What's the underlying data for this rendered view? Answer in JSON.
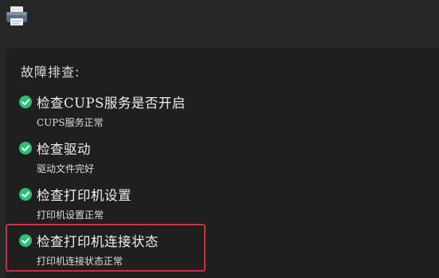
{
  "panel": {
    "title": "故障排查:"
  },
  "steps": [
    {
      "title": "检查CUPS服务是否开启",
      "status": "CUPS服务正常",
      "state": "success"
    },
    {
      "title": "检查驱动",
      "status": "驱动文件完好",
      "state": "success"
    },
    {
      "title": "检查打印机设置",
      "status": "打印机设置正常",
      "state": "success"
    },
    {
      "title": "检查打印机连接状态",
      "status": "打印机连接状态正常",
      "state": "success"
    }
  ],
  "colors": {
    "success": "#2fbf71",
    "highlight": "#c8313f",
    "background": "#262626",
    "panel": "#1f1f1f"
  },
  "icons": {
    "app": "printer-icon",
    "step_state": "check-circle-icon"
  }
}
